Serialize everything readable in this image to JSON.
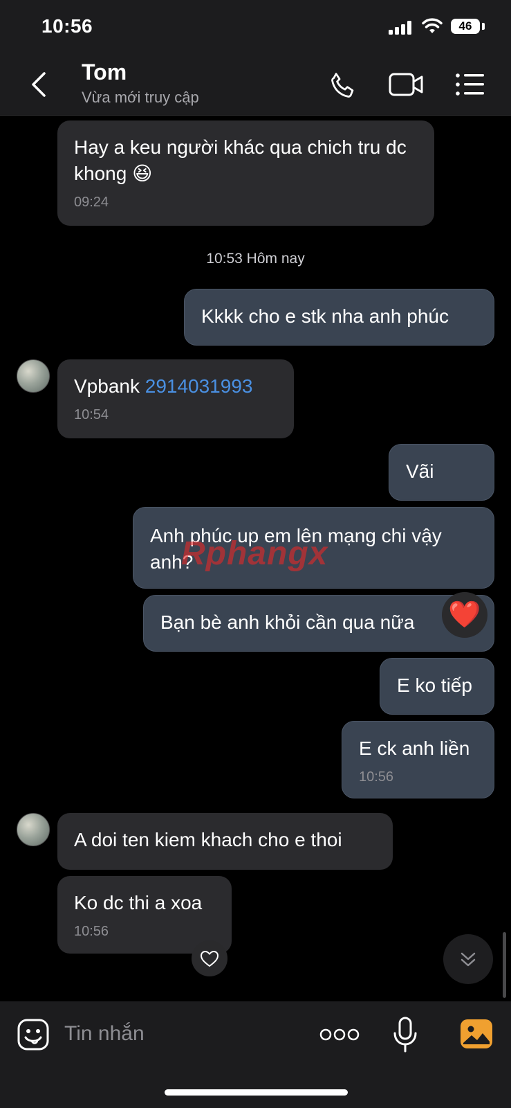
{
  "status": {
    "time": "10:56",
    "battery": "46"
  },
  "header": {
    "contact_name": "Tom",
    "presence": "Vừa mới truy cập"
  },
  "messages": {
    "m1": {
      "text": "Hay a keu người khác qua chich tru dc khong",
      "emoji": "😆",
      "time": "09:24"
    },
    "separator": "10:53 Hôm nay",
    "m2": {
      "text": "Kkkk cho e stk nha anh phúc"
    },
    "m3": {
      "bank": "Vpbank",
      "account": "2914031993",
      "time": "10:54"
    },
    "m4": {
      "text": "Vãi"
    },
    "m5": {
      "text": "Anh phúc up em lên mạng chi vậy anh?"
    },
    "m6": {
      "text": "Bạn bè anh khỏi cần qua nữa",
      "reaction": "❤️"
    },
    "m7": {
      "text": "E ko tiếp"
    },
    "m8": {
      "text": "E ck anh liền",
      "time": "10:56"
    },
    "m9": {
      "text": "A doi ten kiem khach cho e thoi"
    },
    "m10": {
      "text": "Ko dc thi a xoa",
      "time": "10:56"
    }
  },
  "watermark": {
    "part1": "Rphang",
    "part2": "x"
  },
  "composer": {
    "placeholder": "Tin nhắn"
  },
  "icons": {
    "signal": "signal-icon",
    "wifi": "wifi-icon",
    "back": "back-icon",
    "call": "phone-icon",
    "video": "video-icon",
    "menu": "menu-icon",
    "sticker": "sticker-icon",
    "more": "more-icon",
    "mic": "mic-icon",
    "gallery": "image-icon",
    "heart": "heart-icon",
    "scroll": "chevron-down-icon"
  },
  "colors": {
    "background": "#000000",
    "incoming": "#2b2b2e",
    "outgoing": "#3a4452",
    "link": "#4a90e2",
    "gallery": "#f0a030"
  }
}
